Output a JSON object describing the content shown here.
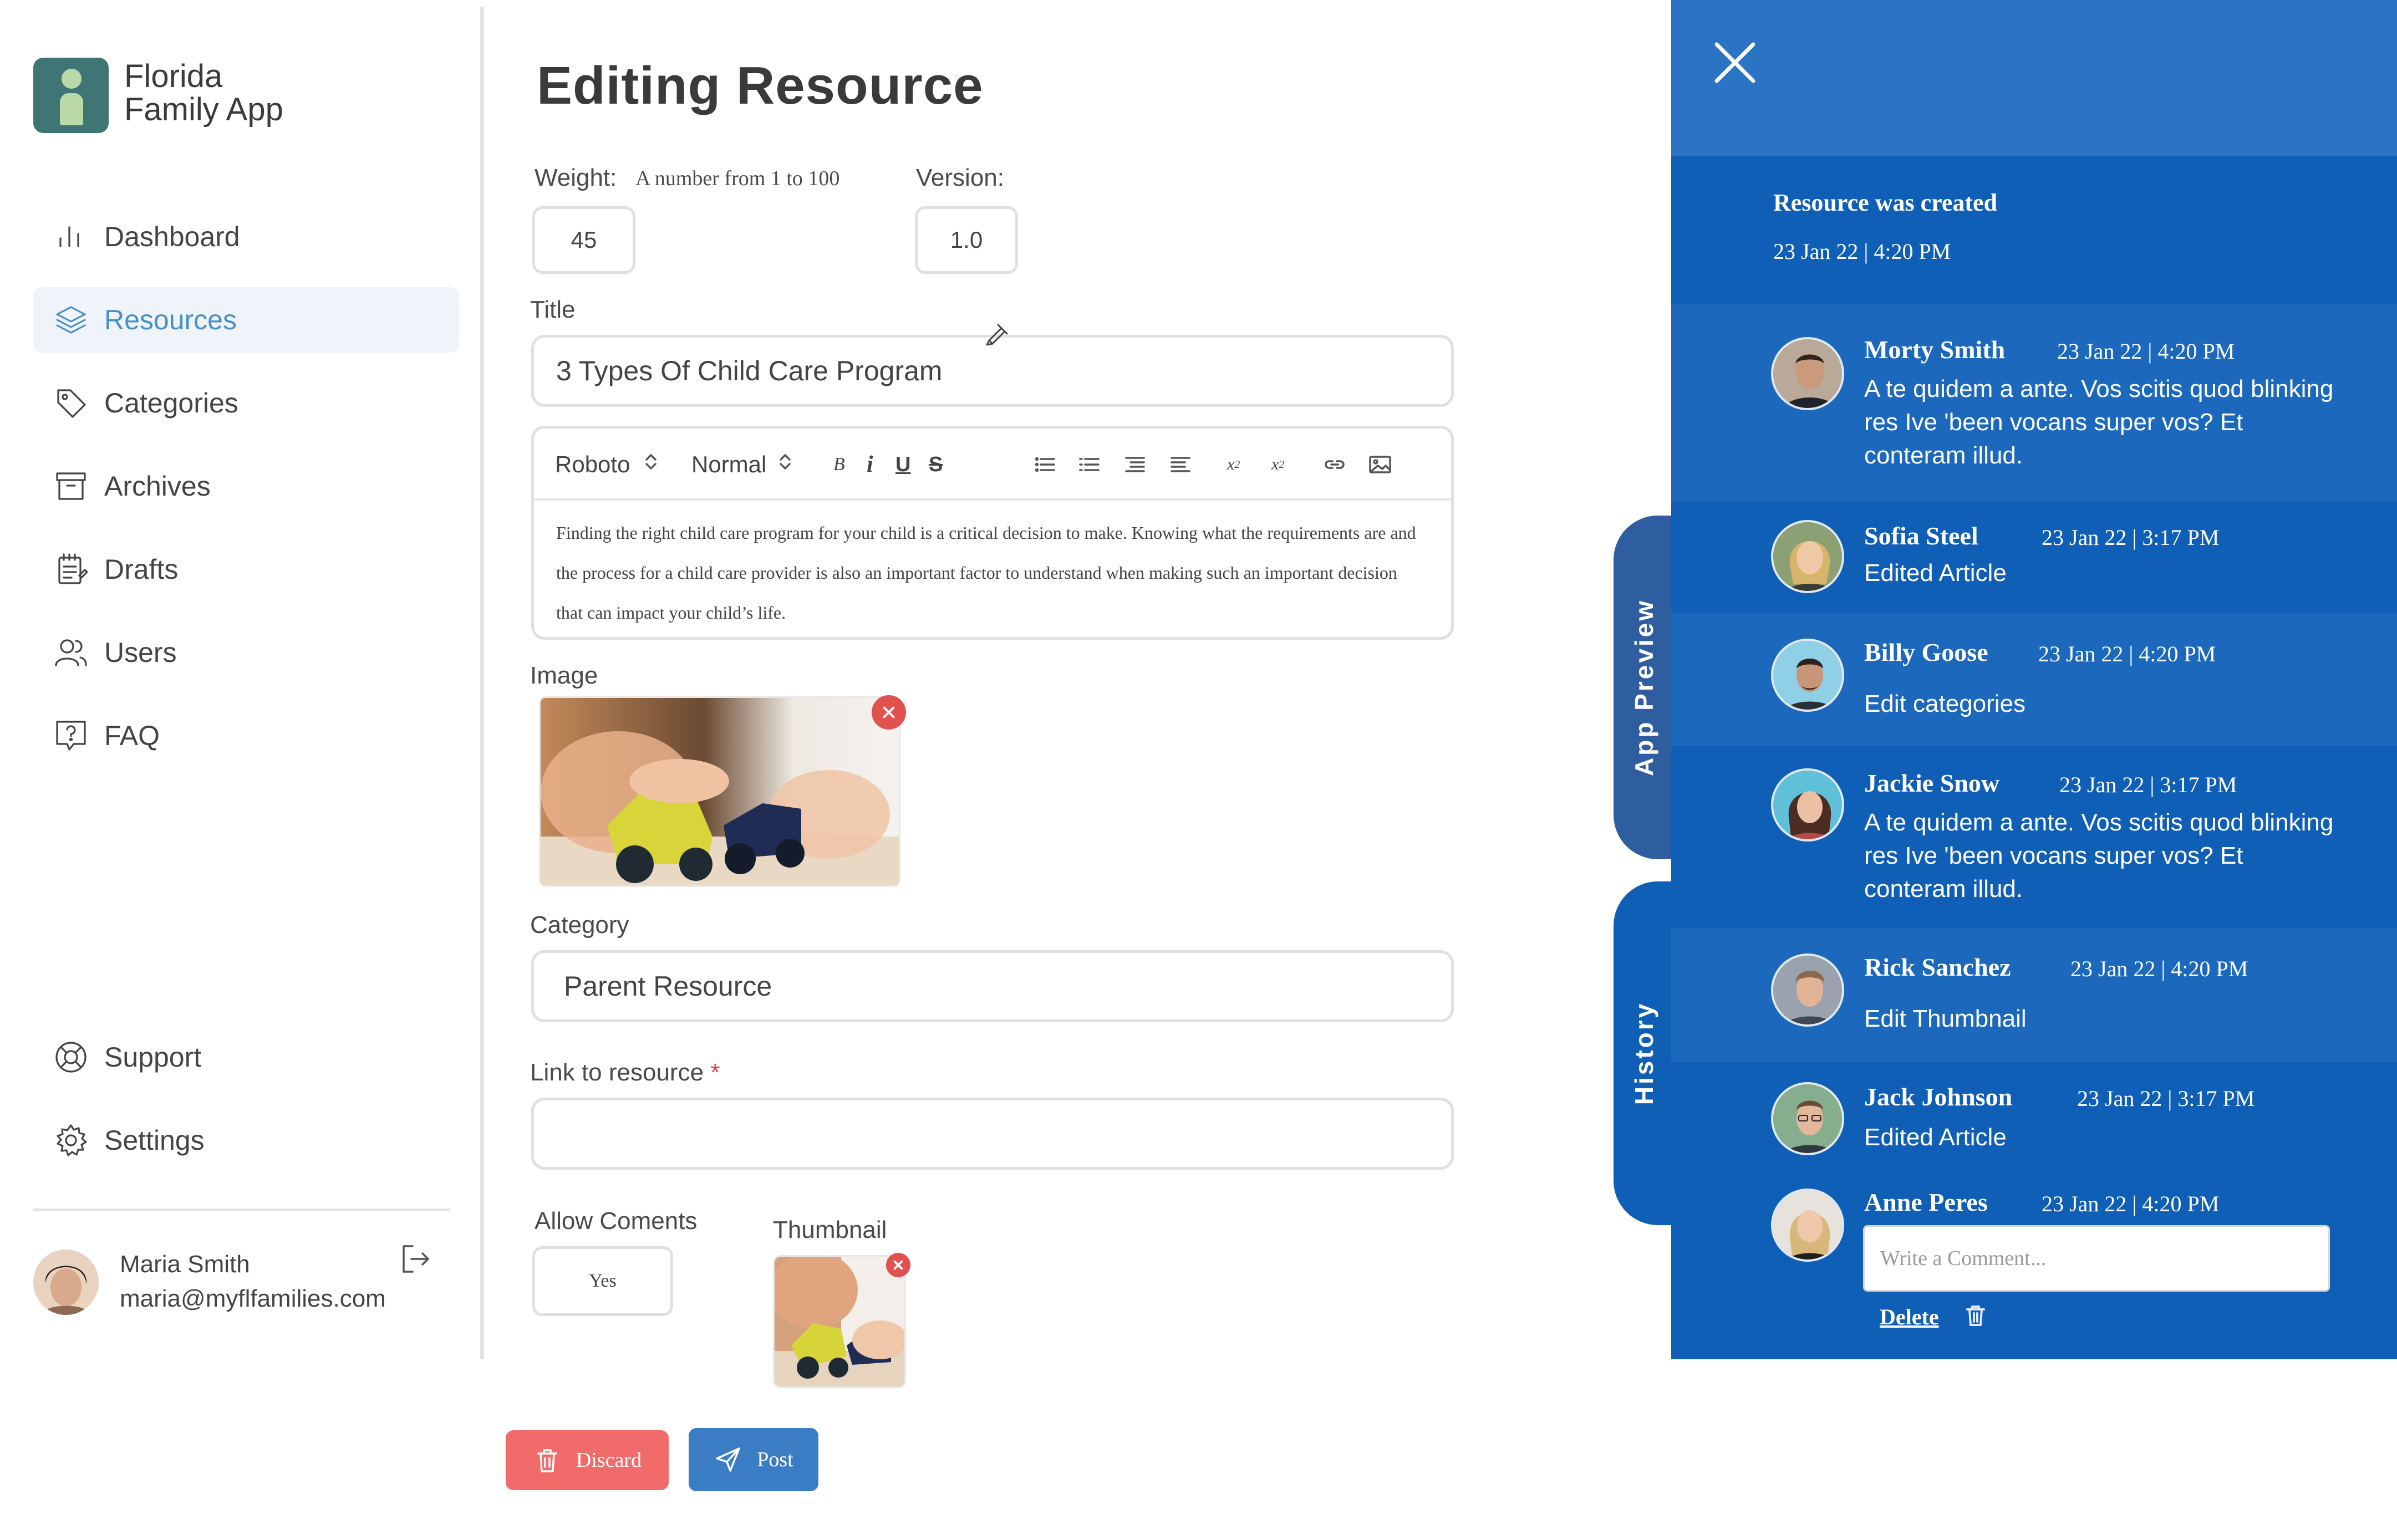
{
  "app": {
    "name_line1": "Florida",
    "name_line2": "Family App"
  },
  "sidebar": {
    "items": [
      {
        "label": "Dashboard",
        "icon": "bar-chart-icon"
      },
      {
        "label": "Resources",
        "icon": "layers-icon",
        "active": true
      },
      {
        "label": "Categories",
        "icon": "tag-icon"
      },
      {
        "label": "Archives",
        "icon": "archive-box-icon"
      },
      {
        "label": "Drafts",
        "icon": "notepad-icon"
      },
      {
        "label": "Users",
        "icon": "users-icon"
      },
      {
        "label": "FAQ",
        "icon": "question-box-icon"
      }
    ],
    "bottom": [
      {
        "label": "Support",
        "icon": "lifebuoy-icon"
      },
      {
        "label": "Settings",
        "icon": "gear-icon"
      }
    ],
    "user": {
      "name": "Maria Smith",
      "email": "maria@myflfamilies.com"
    }
  },
  "main": {
    "title": "Editing Resource",
    "weight": {
      "label": "Weight:",
      "hint": "A number from 1 to 100",
      "value": "45"
    },
    "version": {
      "label": "Version:",
      "value": "1.0"
    },
    "title_field": {
      "label": "Title",
      "value": "3 Types Of Child Care Program"
    },
    "editor": {
      "font": "Roboto",
      "style": "Normal",
      "body": "Finding the right child care program for your child is a critical decision to make. Knowing what the requirements are and the process for a child care provider is also an important factor to understand when making such an important decision that can impact your child’s life."
    },
    "image_label": "Image",
    "category": {
      "label": "Category",
      "value": "Parent Resource"
    },
    "link": {
      "label": "Link to resource",
      "required_mark": "*",
      "value": ""
    },
    "allow_comments": {
      "label": "Allow Coments",
      "value": "Yes"
    },
    "thumbnail_label": "Thumbnail",
    "discard_label": "Discard",
    "post_label": "Post"
  },
  "panel": {
    "tabs": {
      "preview": "App Preview",
      "history": "History"
    },
    "created": {
      "title": "Resource was created",
      "date": "23 Jan 22",
      "time": "4:20 PM"
    },
    "entries": [
      {
        "name": "Morty Smith",
        "date": "23 Jan 22",
        "time": "4:20 PM",
        "text": "A te quidem a ante. Vos scitis quod blinking res Ive 'been vocans super vos? Et conteram illud."
      },
      {
        "name": "Sofia Steel",
        "date": "23 Jan 22",
        "time": "3:17 PM",
        "text": "Edited Article"
      },
      {
        "name": "Billy Goose",
        "date": "23 Jan 22",
        "time": "4:20 PM",
        "text": "Edit categories"
      },
      {
        "name": "Jackie Snow",
        "date": "23 Jan 22",
        "time": "3:17 PM",
        "text": "A te quidem a ante. Vos scitis quod blinking res Ive 'been vocans super vos? Et conteram illud."
      },
      {
        "name": "Rick Sanchez",
        "date": "23 Jan 22",
        "time": "4:20 PM",
        "text": "Edit Thumbnail"
      },
      {
        "name": "Jack Johnson",
        "date": "23 Jan 22",
        "time": "3:17 PM",
        "text": "Edited Article"
      },
      {
        "name": "Anne Peres",
        "date": "23 Jan 22",
        "time": "4:20 PM",
        "text": ""
      }
    ],
    "comment_placeholder": "Write a Comment...",
    "delete_label": "Delete"
  },
  "colors": {
    "accent": "#4a90c8",
    "panel_blue": "#0f5fb6",
    "panel_top": "#2b74c4",
    "tab_blue": "#2f5ea0",
    "discard_red": "#f26b6b",
    "post_blue": "#3b7dc4",
    "logo_teal": "#3f7675"
  }
}
